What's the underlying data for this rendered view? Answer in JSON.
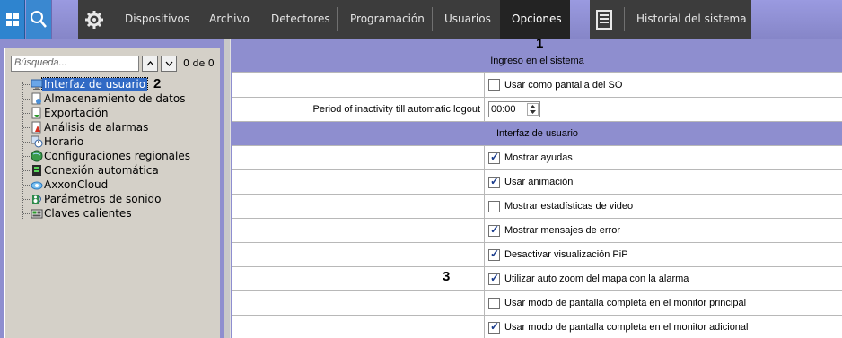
{
  "toolbar": {
    "items": [
      "Dispositivos",
      "Archivo",
      "Detectores",
      "Programación",
      "Usuarios",
      "Opciones"
    ],
    "active": "Opciones",
    "history_label": "Historial del sistema"
  },
  "callouts": {
    "one": "1",
    "two": "2",
    "three": "3"
  },
  "left": {
    "search_placeholder": "Búsqueda...",
    "count": "0 de 0",
    "tree": [
      {
        "label": "Interfaz de usuario",
        "icon": "monitor-icon",
        "selected": true
      },
      {
        "label": "Almacenamiento de datos",
        "icon": "database-file-icon"
      },
      {
        "label": "Exportación",
        "icon": "export-icon"
      },
      {
        "label": "Análisis de alarmas",
        "icon": "alarm-icon"
      },
      {
        "label": "Horario",
        "icon": "clock-icon"
      },
      {
        "label": "Configuraciones regionales",
        "icon": "globe-icon"
      },
      {
        "label": "Conexión automática",
        "icon": "server-icon"
      },
      {
        "label": "AxxonCloud",
        "icon": "cloud-icon"
      },
      {
        "label": "Parámetros de sonido",
        "icon": "speaker-icon"
      },
      {
        "label": "Claves calientes",
        "icon": "keyboard-icon"
      }
    ]
  },
  "grid": {
    "section1": "Ingreso en el sistema",
    "use_as_shell": {
      "label": "Usar como pantalla del SO",
      "checked": false
    },
    "inactivity_label": "Period of inactivity till automatic logout",
    "inactivity_value": "00:00",
    "section2": "Interfaz de usuario",
    "options": [
      {
        "label": "Mostrar ayudas",
        "checked": true
      },
      {
        "label": "Usar animación",
        "checked": true
      },
      {
        "label": "Mostrar estadísticas de video",
        "checked": false
      },
      {
        "label": "Mostrar mensajes de error",
        "checked": true
      },
      {
        "label": "Desactivar visualización PiP",
        "checked": true
      },
      {
        "label": "Utilizar auto zoom del mapa con la alarma",
        "checked": true
      },
      {
        "label": "Usar modo de pantalla completa en el monitor principal",
        "checked": false
      },
      {
        "label": "Usar modo de pantalla completa en el monitor adicional",
        "checked": true
      }
    ]
  },
  "colors": {
    "accent": "#8e8ecf",
    "toolbar_dark": "#3c3c3c",
    "selection": "#316ac5"
  }
}
